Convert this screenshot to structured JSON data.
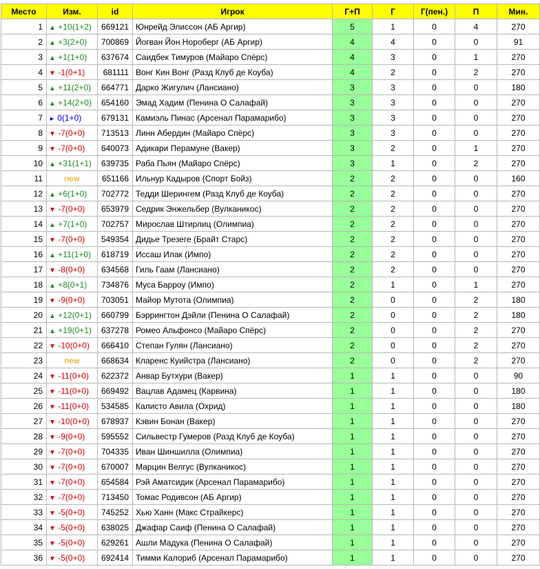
{
  "headers": [
    "Место",
    "Изм.",
    "id",
    "Игрок",
    "Г+П",
    "Г",
    "Г(пен.)",
    "П",
    "Мин."
  ],
  "colors": {
    "header_bg": "#ffff00",
    "gp_bg": "#99ff99",
    "up": "#1e8a1e",
    "down": "#d00000",
    "same": "#0000ff",
    "new": "#e6a000"
  },
  "rows": [
    {
      "place": "1",
      "dir": "up",
      "chg": "+10(1+2)",
      "id": "669121",
      "player": "Юнрейд Элиссон (АБ Аргир)",
      "gp": "5",
      "g": "1",
      "gpen": "0",
      "p": "4",
      "min": "270"
    },
    {
      "place": "2",
      "dir": "up",
      "chg": "+3(2+0)",
      "id": "700869",
      "player": "Йогван Йон Нороберг (АБ Аргир)",
      "gp": "4",
      "g": "4",
      "gpen": "0",
      "p": "0",
      "min": "91"
    },
    {
      "place": "3",
      "dir": "up",
      "chg": "+1(1+0)",
      "id": "637674",
      "player": "Саидбек Тимуров (Майаро Спёрс)",
      "gp": "4",
      "g": "3",
      "gpen": "0",
      "p": "1",
      "min": "270"
    },
    {
      "place": "4",
      "dir": "down",
      "chg": "-1(0+1)",
      "id": "681111",
      "player": "Вонг Кин Вонг (Разд Клуб де Коуба)",
      "gp": "4",
      "g": "2",
      "gpen": "0",
      "p": "2",
      "min": "270"
    },
    {
      "place": "5",
      "dir": "up",
      "chg": "+11(2+0)",
      "id": "664771",
      "player": "Дарко Жигулич (Лансиано)",
      "gp": "3",
      "g": "3",
      "gpen": "0",
      "p": "0",
      "min": "180"
    },
    {
      "place": "6",
      "dir": "up",
      "chg": "+14(2+0)",
      "id": "654160",
      "player": "Эмад Хадим (Пенина О Салафай)",
      "gp": "3",
      "g": "3",
      "gpen": "0",
      "p": "0",
      "min": "270"
    },
    {
      "place": "7",
      "dir": "same",
      "chg": "0(1+0)",
      "id": "679131",
      "player": "Камиэль Пинас (Арсенал Парамарибо)",
      "gp": "3",
      "g": "3",
      "gpen": "0",
      "p": "0",
      "min": "270"
    },
    {
      "place": "8",
      "dir": "down",
      "chg": "-7(0+0)",
      "id": "713513",
      "player": "Линн Абердин (Майаро Спёрс)",
      "gp": "3",
      "g": "3",
      "gpen": "0",
      "p": "0",
      "min": "270"
    },
    {
      "place": "9",
      "dir": "down",
      "chg": "-7(0+0)",
      "id": "640073",
      "player": "Адикари Перамуне (Вакер)",
      "gp": "3",
      "g": "2",
      "gpen": "0",
      "p": "1",
      "min": "270"
    },
    {
      "place": "10",
      "dir": "up",
      "chg": "+31(1+1)",
      "id": "639735",
      "player": "Раба Пьян (Майаро Спёрс)",
      "gp": "3",
      "g": "1",
      "gpen": "0",
      "p": "2",
      "min": "270"
    },
    {
      "place": "11",
      "dir": "new",
      "chg": "new",
      "id": "651166",
      "player": "Ильнур Кадыров (Спорт Бойз)",
      "gp": "2",
      "g": "2",
      "gpen": "0",
      "p": "0",
      "min": "160"
    },
    {
      "place": "12",
      "dir": "up",
      "chg": "+6(1+0)",
      "id": "702772",
      "player": "Тедди Шерингем (Разд Клуб де Коуба)",
      "gp": "2",
      "g": "2",
      "gpen": "0",
      "p": "0",
      "min": "270"
    },
    {
      "place": "13",
      "dir": "down",
      "chg": "-7(0+0)",
      "id": "653979",
      "player": "Седрик Энжельбер (Вулканикос)",
      "gp": "2",
      "g": "2",
      "gpen": "0",
      "p": "0",
      "min": "270"
    },
    {
      "place": "14",
      "dir": "up",
      "chg": "+7(1+0)",
      "id": "702757",
      "player": "Мирослав Штирлиц (Олимпиа)",
      "gp": "2",
      "g": "2",
      "gpen": "0",
      "p": "0",
      "min": "270"
    },
    {
      "place": "15",
      "dir": "down",
      "chg": "-7(0+0)",
      "id": "549354",
      "player": "Дидье Трезеге (Брайт Старс)",
      "gp": "2",
      "g": "2",
      "gpen": "0",
      "p": "0",
      "min": "270"
    },
    {
      "place": "16",
      "dir": "up",
      "chg": "+11(1+0)",
      "id": "618719",
      "player": "Иссаш Илак (Импо)",
      "gp": "2",
      "g": "2",
      "gpen": "0",
      "p": "0",
      "min": "270"
    },
    {
      "place": "17",
      "dir": "down",
      "chg": "-8(0+0)",
      "id": "634568",
      "player": "Гиль Гаам (Лансиано)",
      "gp": "2",
      "g": "2",
      "gpen": "0",
      "p": "0",
      "min": "270"
    },
    {
      "place": "18",
      "dir": "up",
      "chg": "+8(0+1)",
      "id": "734876",
      "player": "Муса Барроу (Импо)",
      "gp": "2",
      "g": "1",
      "gpen": "0",
      "p": "1",
      "min": "270"
    },
    {
      "place": "19",
      "dir": "down",
      "chg": "-9(0+0)",
      "id": "703051",
      "player": "Майор Мутота (Олимпиа)",
      "gp": "2",
      "g": "0",
      "gpen": "0",
      "p": "2",
      "min": "180"
    },
    {
      "place": "20",
      "dir": "up",
      "chg": "+12(0+1)",
      "id": "660799",
      "player": "Бэррингтон Дэйли (Пенина О Салафай)",
      "gp": "2",
      "g": "0",
      "gpen": "0",
      "p": "2",
      "min": "180"
    },
    {
      "place": "21",
      "dir": "up",
      "chg": "+19(0+1)",
      "id": "637278",
      "player": "Ромео Альфонсо (Майаро Спёрс)",
      "gp": "2",
      "g": "0",
      "gpen": "0",
      "p": "2",
      "min": "270"
    },
    {
      "place": "22",
      "dir": "down",
      "chg": "-10(0+0)",
      "id": "666410",
      "player": "Степан Гулян (Лансиано)",
      "gp": "2",
      "g": "0",
      "gpen": "0",
      "p": "2",
      "min": "270"
    },
    {
      "place": "23",
      "dir": "new",
      "chg": "new",
      "id": "668634",
      "player": "Кларенс Куийстра (Лансиано)",
      "gp": "2",
      "g": "0",
      "gpen": "0",
      "p": "2",
      "min": "270"
    },
    {
      "place": "24",
      "dir": "down",
      "chg": "-11(0+0)",
      "id": "622372",
      "player": "Анвар Бутхури (Вакер)",
      "gp": "1",
      "g": "1",
      "gpen": "0",
      "p": "0",
      "min": "90"
    },
    {
      "place": "25",
      "dir": "down",
      "chg": "-11(0+0)",
      "id": "669492",
      "player": "Вацлав Адамец (Карвина)",
      "gp": "1",
      "g": "1",
      "gpen": "0",
      "p": "0",
      "min": "180"
    },
    {
      "place": "26",
      "dir": "down",
      "chg": "-11(0+0)",
      "id": "534585",
      "player": "Калисто Авила (Охрид)",
      "gp": "1",
      "g": "1",
      "gpen": "0",
      "p": "0",
      "min": "180"
    },
    {
      "place": "27",
      "dir": "down",
      "chg": "-10(0+0)",
      "id": "678937",
      "player": "Кэвин Бонан (Вакер)",
      "gp": "1",
      "g": "1",
      "gpen": "0",
      "p": "0",
      "min": "270"
    },
    {
      "place": "28",
      "dir": "down",
      "chg": "-9(0+0)",
      "id": "595552",
      "player": "Сильвестр Гумеров (Разд Клуб де Коуба)",
      "gp": "1",
      "g": "1",
      "gpen": "0",
      "p": "0",
      "min": "270"
    },
    {
      "place": "29",
      "dir": "down",
      "chg": "-7(0+0)",
      "id": "704335",
      "player": "Иван Шиншилла (Олимпиа)",
      "gp": "1",
      "g": "1",
      "gpen": "0",
      "p": "0",
      "min": "270"
    },
    {
      "place": "30",
      "dir": "down",
      "chg": "-7(0+0)",
      "id": "670007",
      "player": "Марцин Велгус (Вулканикос)",
      "gp": "1",
      "g": "1",
      "gpen": "0",
      "p": "0",
      "min": "270"
    },
    {
      "place": "31",
      "dir": "down",
      "chg": "-7(0+0)",
      "id": "654584",
      "player": "Рэй Аматсидик (Арсенал Парамарибо)",
      "gp": "1",
      "g": "1",
      "gpen": "0",
      "p": "0",
      "min": "270"
    },
    {
      "place": "32",
      "dir": "down",
      "chg": "-7(0+0)",
      "id": "713450",
      "player": "Томас Родивсон (АБ Аргир)",
      "gp": "1",
      "g": "1",
      "gpen": "0",
      "p": "0",
      "min": "270"
    },
    {
      "place": "33",
      "dir": "down",
      "chg": "-5(0+0)",
      "id": "745252",
      "player": "Хью Ханн (Макс Страйкерс)",
      "gp": "1",
      "g": "1",
      "gpen": "0",
      "p": "0",
      "min": "270"
    },
    {
      "place": "34",
      "dir": "down",
      "chg": "-5(0+0)",
      "id": "638025",
      "player": "Джафар Саиф (Пенина О Салафай)",
      "gp": "1",
      "g": "1",
      "gpen": "0",
      "p": "0",
      "min": "270"
    },
    {
      "place": "35",
      "dir": "down",
      "chg": "-5(0+0)",
      "id": "629261",
      "player": "Ашли Мадука (Пенина О Салафай)",
      "gp": "1",
      "g": "1",
      "gpen": "0",
      "p": "0",
      "min": "270"
    },
    {
      "place": "36",
      "dir": "down",
      "chg": "-5(0+0)",
      "id": "692414",
      "player": "Тимми Калориб (Арсенал Парамарибо)",
      "gp": "1",
      "g": "1",
      "gpen": "0",
      "p": "0",
      "min": "270"
    }
  ]
}
